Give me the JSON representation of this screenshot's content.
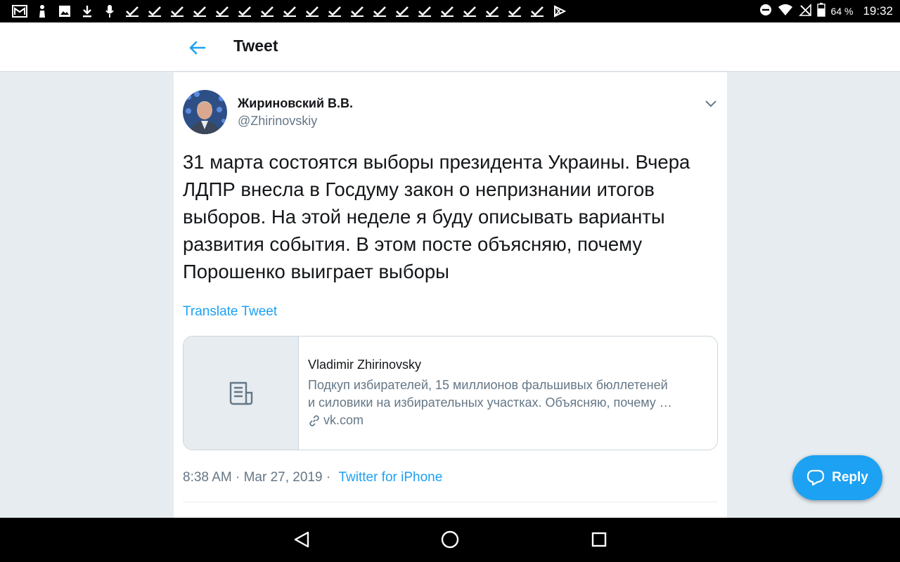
{
  "status_bar": {
    "battery": "64 %",
    "time": "19:32",
    "left_icons": [
      "gmail-icon",
      "figure-icon",
      "image-icon",
      "download-icon",
      "mic-icon",
      "check-icon",
      "check-icon",
      "check-icon",
      "check-icon",
      "check-icon",
      "check-icon",
      "check-icon",
      "check-icon",
      "check-icon",
      "check-icon",
      "check-icon",
      "check-icon",
      "check-icon",
      "check-icon",
      "check-icon",
      "check-icon",
      "check-icon",
      "check-icon",
      "check-icon",
      "play-store-icon"
    ],
    "right_icons": [
      "do-not-disturb-icon",
      "wifi-icon",
      "no-signal-icon",
      "battery-icon"
    ]
  },
  "header": {
    "title": "Tweet",
    "back_icon": "arrow-left-icon"
  },
  "tweet": {
    "author_name": "Жириновский В.В.",
    "author_handle": "@Zhirinovskiy",
    "text": "31 марта состоятся выборы президента Украины. Вчера ЛДПР внесла в Госдуму закон о непризнании итогов выборов. На этой неделе я буду описывать варианты развития события. В этом посте объясняю, почему Порошенко выиграет выборы",
    "translate_label": "Translate Tweet",
    "card": {
      "title": "Vladimir Zhirinovsky",
      "description": "Подкуп избирателей, 15 миллионов фальшивых бюллетеней\nи силовики на избирательных участках. Объясняю, почему …",
      "domain": "vk.com"
    },
    "timestamp": "8:38 AM · Mar 27, 2019 · ",
    "source": "Twitter for iPhone"
  },
  "reply_button": {
    "label": "Reply"
  },
  "colors": {
    "accent": "#1da1f2",
    "text": "#14171a",
    "secondary": "#657786",
    "background": "#e6ecf0"
  }
}
